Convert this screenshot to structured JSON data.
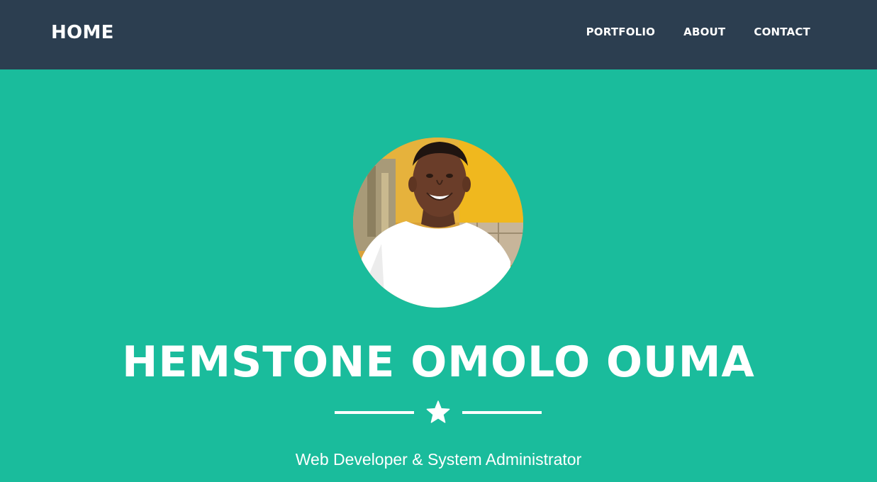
{
  "colors": {
    "nav_background": "#2c3e50",
    "hero_background": "#1abc9c",
    "text": "#ffffff"
  },
  "navbar": {
    "brand": "HOME",
    "links": [
      {
        "label": "PORTFOLIO"
      },
      {
        "label": "ABOUT"
      },
      {
        "label": "CONTACT"
      }
    ]
  },
  "hero": {
    "avatar_icon": "profile-photo",
    "name": "HEMSTONE OMOLO OUMA",
    "divider_icon": "star-icon",
    "subtitle": "Web Developer & System Administrator"
  }
}
